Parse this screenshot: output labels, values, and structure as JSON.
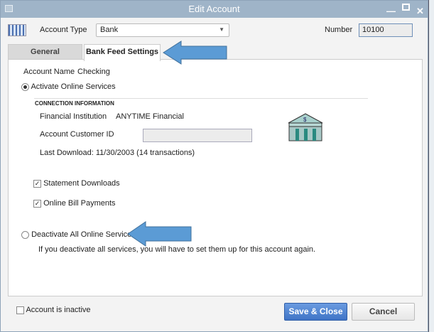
{
  "window": {
    "title": "Edit Account"
  },
  "header": {
    "account_type_label": "Account Type",
    "account_type_value": "Bank",
    "number_label": "Number",
    "number_value": "10100"
  },
  "tabs": [
    {
      "label": "General"
    },
    {
      "label": "Bank Feed Settings"
    }
  ],
  "panel": {
    "account_name_label": "Account Name",
    "account_name_value": "Checking",
    "activate_label": "Activate Online Services",
    "section_header": "CONNECTION INFORMATION",
    "fi_label": "Financial Institution",
    "fi_value": "ANYTIME Financial",
    "customer_id_label": "Account Customer ID",
    "customer_id_value": "",
    "last_download": "Last Download: 11/30/2003 (14 transactions)",
    "statement_downloads": "Statement Downloads",
    "bill_payments": "Online Bill Payments",
    "deactivate_label": "Deactivate All Online Services",
    "deactivate_note": "If you deactivate all services, you will have to set them up for this account again."
  },
  "footer": {
    "inactive_label": "Account is inactive",
    "save_label": "Save & Close",
    "cancel_label": "Cancel"
  },
  "colors": {
    "arrow": "#5b9bd5",
    "save": "#4a7fd0"
  }
}
